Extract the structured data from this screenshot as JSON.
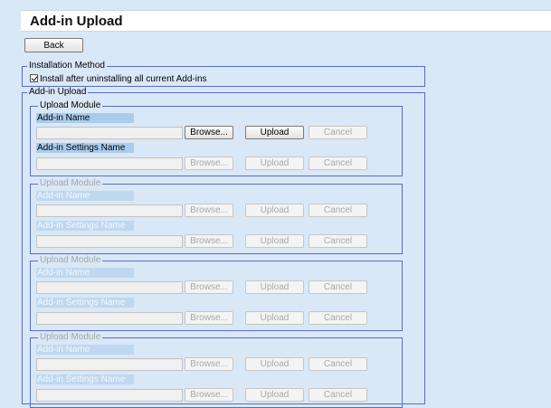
{
  "page": {
    "title": "Add-in Upload",
    "back_label": "Back"
  },
  "installation": {
    "legend": "Installation Method",
    "checkbox_label": "Install after uninstalling all current Add-ins",
    "checked": true
  },
  "upload": {
    "legend": "Add-in Upload",
    "modules": [
      {
        "legend": "Upload Module",
        "addin_label": "Add-in Name",
        "settings_label": "Add-in Settings Name",
        "addin_value": "",
        "settings_value": "",
        "browse_label": "Browse...",
        "upload_label": "Upload",
        "cancel_label": "Cancel",
        "enabled": true
      },
      {
        "legend": "Upload Module",
        "addin_label": "Add-in Name",
        "settings_label": "Add-in Settings Name",
        "addin_value": "",
        "settings_value": "",
        "browse_label": "Browse...",
        "upload_label": "Upload",
        "cancel_label": "Cancel",
        "enabled": false
      },
      {
        "legend": "Upload Module",
        "addin_label": "Add-in Name",
        "settings_label": "Add-in Settings Name",
        "addin_value": "",
        "settings_value": "",
        "browse_label": "Browse...",
        "upload_label": "Upload",
        "cancel_label": "Cancel",
        "enabled": false
      },
      {
        "legend": "Upload Module",
        "addin_label": "Add-in Name",
        "settings_label": "Add-in Settings Name",
        "addin_value": "",
        "settings_value": "",
        "browse_label": "Browse...",
        "upload_label": "Upload",
        "cancel_label": "Cancel",
        "enabled": false
      }
    ]
  }
}
